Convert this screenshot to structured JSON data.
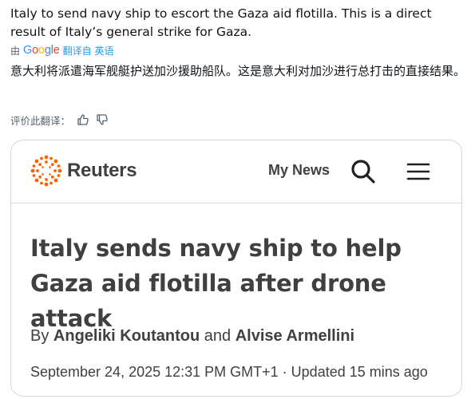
{
  "post": {
    "text": "Italy to send navy ship to escort the Gaza aid flotilla. This is a direct result of Italy’s general strike for Gaza.",
    "translated_by_prefix": "由",
    "google_letters": [
      "G",
      "o",
      "o",
      "g",
      "l",
      "e"
    ],
    "translated_by_suffix": "翻译自 英语",
    "translated_text": "意大利将派遣海军舰艇护送加沙援助船队。这是意大利对加沙进行总打击的直接结果。",
    "rate_label": "评价此翻译：",
    "thumbs_up_icon": "thumbs-up-icon",
    "thumbs_down_icon": "thumbs-down-icon"
  },
  "card": {
    "brand": "Reuters",
    "brand_color": "#fa6400",
    "nav_my_news": "My News",
    "headline": "Italy sends navy ship to help Gaza aid flotilla after drone attack",
    "byline_prefix": "By",
    "author1": "Angeliki Koutantou",
    "byline_and": "and",
    "author2": "Alvise Armellini",
    "dateline": "September 24, 2025 12:31 PM GMT+1 · Updated 15 mins ago"
  },
  "colors": {
    "text": "#0f1419",
    "muted": "#536471",
    "link": "#1d9bf0",
    "card_border": "#cfd9de",
    "reuters_text": "#404040"
  }
}
